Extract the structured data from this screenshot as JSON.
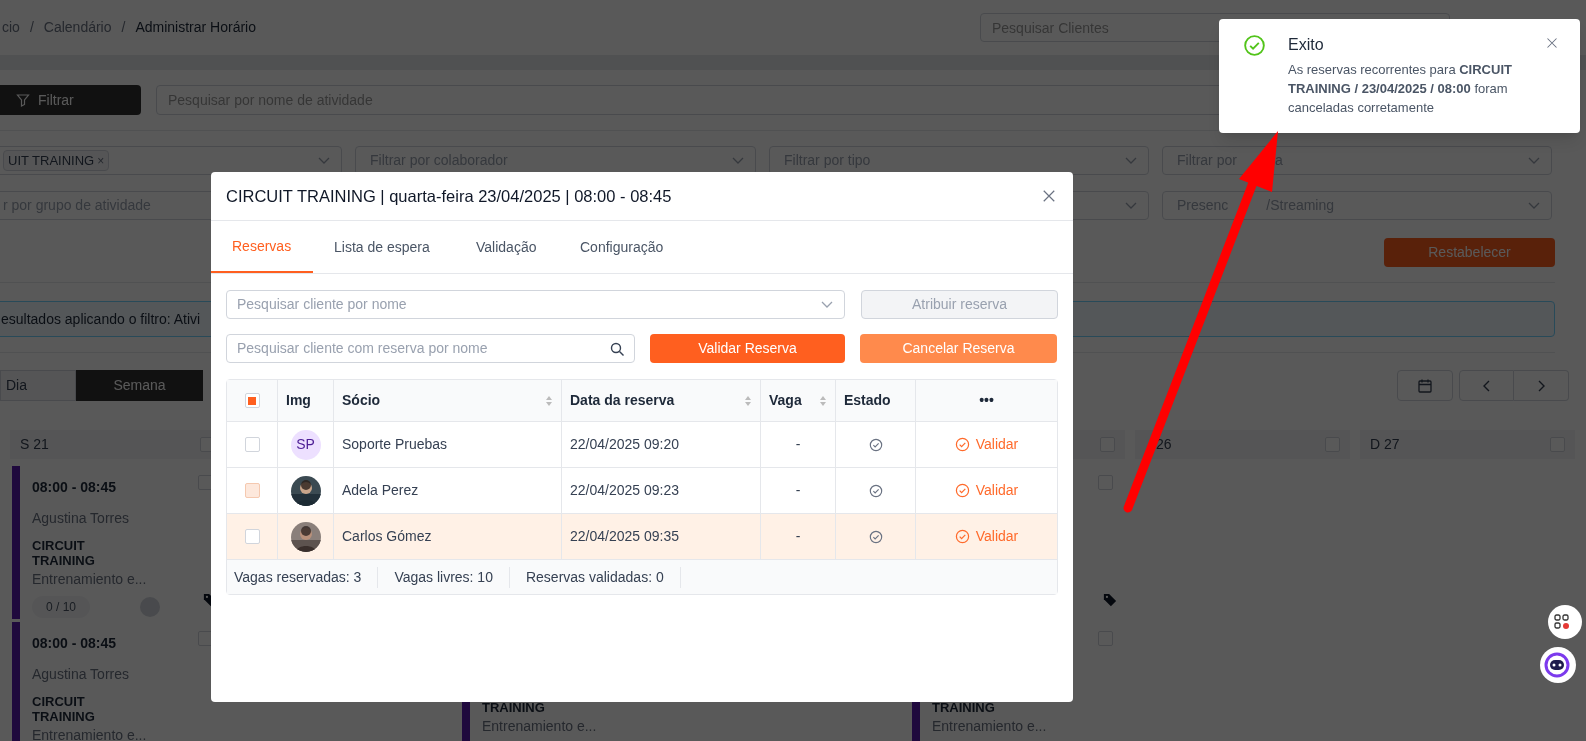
{
  "breadcrumb": {
    "items": [
      "cio",
      "Calendário",
      "Administrar Horário"
    ],
    "separator": "/"
  },
  "client_search": {
    "placeholder": "Pesquisar Clientes"
  },
  "filter_button": "Filtrar",
  "activity_search": {
    "placeholder": "Pesquisar por nome de atividade"
  },
  "filters": [
    [
      {
        "kind": "tags",
        "tags": [
          "UIT TRAINING"
        ],
        "remove": "×"
      },
      {
        "kind": "select",
        "placeholder": "Filtrar por colaborador"
      },
      {
        "kind": "select",
        "placeholder": "Filtrar por tipo"
      },
      {
        "kind": "select",
        "placeholder_parts": [
          "Filtrar por",
          "a"
        ]
      }
    ],
    [
      {
        "kind": "select",
        "placeholder": "r por grupo de atividade"
      },
      {
        "kind": "select"
      },
      {
        "kind": "select",
        "placeholder_parts": [
          "Presenc",
          "/Streaming"
        ]
      }
    ]
  ],
  "reset_button": "Restabelecer",
  "info_text": "esultados aplicando o filtro: Ativi",
  "view_toggle": [
    {
      "label": "Dia",
      "selected": false
    },
    {
      "label": "Semana",
      "selected": true
    }
  ],
  "calendar": {
    "days": [
      {
        "kind": "day",
        "label": "S 21",
        "checked": false,
        "events": [
          {
            "kind": "upper",
            "checked": false,
            "time": "08:00 - 08:45",
            "instructor": "Agustina Torres",
            "title": "CIRCUIT TRAINING",
            "subtitle": "Entrenamiento e...",
            "capacity": "0 / 10",
            "tag": true
          },
          {
            "kind": "lower",
            "checked": false,
            "time": "08:00 - 08:45",
            "instructor": "Agustina Torres",
            "title": "CIRCUIT TRAINING",
            "subtitle": "Entrenamiento e...",
            "tag": false
          }
        ]
      },
      {
        "kind": "covered"
      },
      {
        "kind": "day",
        "events": [
          {
            "kind": "lower",
            "title": "TRAINING",
            "subtitle": "Entrenamiento e...",
            "tag": false
          }
        ]
      },
      {
        "kind": "covered"
      },
      {
        "kind": "day",
        "checked": false,
        "events": [
          {
            "kind": "upper",
            "checked": false,
            "tag": true
          },
          {
            "kind": "lower",
            "checked": false,
            "title": "TRAINING",
            "subtitle": "Entrenamiento e...",
            "tag": false
          }
        ]
      },
      {
        "kind": "day",
        "label": "26",
        "partially_covered": true,
        "checked": false
      },
      {
        "kind": "day",
        "label": "D 27",
        "checked": false
      }
    ]
  },
  "modal": {
    "title": "CIRCUIT TRAINING | quarta-feira 23/04/2025 | 08:00 - 08:45",
    "tabs": [
      {
        "label": "Reservas",
        "selected": true
      },
      {
        "label": "Lista de espera",
        "selected": false
      },
      {
        "label": "Validação",
        "selected": false
      },
      {
        "label": "Configuração",
        "selected": false
      }
    ],
    "client_select": {
      "placeholder": "Pesquisar cliente por nome"
    },
    "assign_button": {
      "label": "Atribuir reserva",
      "disabled": true
    },
    "booking_search": {
      "placeholder": "Pesquisar cliente com reserva por nome"
    },
    "validate_button": "Validar Reserva",
    "cancel_button": "Cancelar Reserva",
    "table": {
      "select_all": {
        "indeterminate": true
      },
      "columns": [
        {
          "label": "Img",
          "sortable": false
        },
        {
          "label": "Sócio",
          "sortable": true
        },
        {
          "label": "Data da reserva",
          "sortable": true
        },
        {
          "label": "Vaga",
          "sortable": true
        },
        {
          "label": "Estado",
          "sortable": false
        },
        {
          "label": "•••",
          "sortable": false
        }
      ],
      "rows": [
        {
          "checked": false,
          "checkbox_tinted": false,
          "highlighted": false,
          "avatar": {
            "kind": "initials",
            "text": "SP"
          },
          "name": "Soporte Pruebas",
          "date": "22/04/2025 09:20",
          "vaga": "-",
          "action": "Validar"
        },
        {
          "checked": false,
          "checkbox_tinted": true,
          "highlighted": false,
          "name": "Adela Perez",
          "date": "22/04/2025 09:23",
          "vaga": "-",
          "action": "Validar"
        },
        {
          "checked": false,
          "checkbox_tinted": false,
          "highlighted": true,
          "name": "Carlos Gómez",
          "date": "22/04/2025 09:35",
          "vaga": "-",
          "action": "Validar"
        }
      ],
      "footer": [
        "Vagas reservadas: 3",
        "Vagas livres: 10",
        "Reservas validadas: 0"
      ]
    }
  },
  "toast": {
    "title": "Exito",
    "message": "As reservas recorrentes para **CIRCUIT TRAINING / 23/04/2025 / 08:00** foram canceladas corretamente"
  }
}
